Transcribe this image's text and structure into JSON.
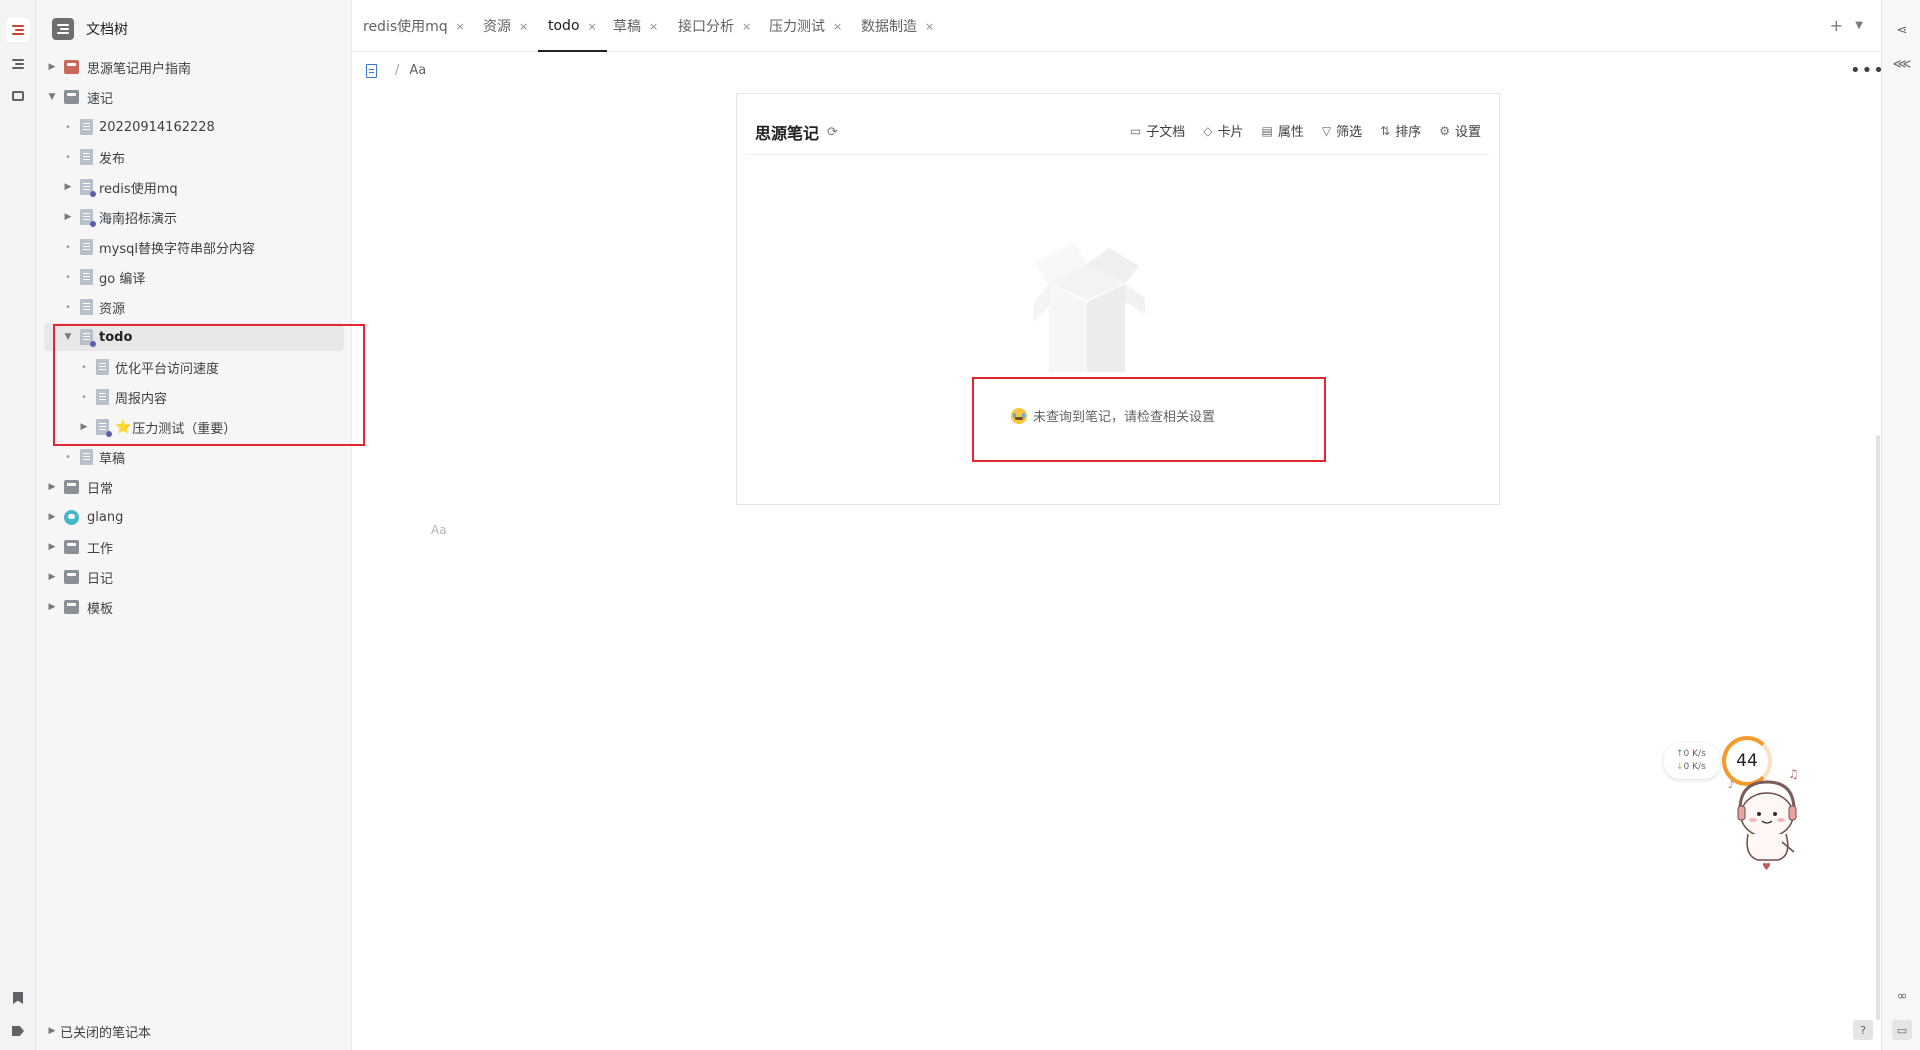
{
  "sidebar": {
    "title": "文档树",
    "items": [
      {
        "label": "思源笔记用户指南"
      },
      {
        "label": "速记"
      },
      {
        "label": "20220914162228"
      },
      {
        "label": "发布"
      },
      {
        "label": "redis使用mq"
      },
      {
        "label": "海南招标演示"
      },
      {
        "label": "mysql替换字符串部分内容"
      },
      {
        "label": "go 编译"
      },
      {
        "label": "资源"
      },
      {
        "label": "todo"
      },
      {
        "label": "优化平台访问速度"
      },
      {
        "label": "周报内容"
      },
      {
        "label": "压力测试（重要）",
        "icon": "⭐"
      },
      {
        "label": "草稿"
      },
      {
        "label": "日常"
      },
      {
        "label": "glang"
      },
      {
        "label": "工作"
      },
      {
        "label": "日记"
      },
      {
        "label": "模板"
      }
    ],
    "closed_notebooks": "已关闭的笔记本"
  },
  "tabs": [
    {
      "label": "redis使用mq"
    },
    {
      "label": "资源"
    },
    {
      "label": "todo"
    },
    {
      "label": "草稿"
    },
    {
      "label": "接口分析"
    },
    {
      "label": "压力测试"
    },
    {
      "label": "数据制造"
    }
  ],
  "tab_close": "×",
  "tab_add": "+",
  "tab_more": "▼",
  "breadcrumb": {
    "separator": "/",
    "current": "Aa"
  },
  "more_menu": "•••",
  "embed": {
    "title": "思源笔记",
    "refresh": "⟳",
    "tools": [
      {
        "label": "子文档",
        "icon": "folder-icon",
        "glyph": "▭"
      },
      {
        "label": "卡片",
        "icon": "card-icon",
        "glyph": "◇"
      },
      {
        "label": "属性",
        "icon": "attribute-icon",
        "glyph": "▤"
      },
      {
        "label": "筛选",
        "icon": "filter-icon",
        "glyph": "▽"
      },
      {
        "label": "排序",
        "icon": "sort-icon",
        "glyph": "⇅"
      },
      {
        "label": "设置",
        "icon": "gear-icon",
        "glyph": "⚙"
      }
    ],
    "empty_message": "未查询到笔记，请检查相关设置"
  },
  "editor_placeholder": "Aa",
  "network_widget": {
    "up_value": "0",
    "down_value": "0",
    "unit": "K/s",
    "up_arrow": "↑",
    "down_arrow": "↓"
  },
  "cpu_value": "44",
  "colors": {
    "accent": "#d23f31",
    "highlight_box": "#e3262f",
    "tree_bg": "#f6f6f6",
    "cpu_ring": "#f39a2b"
  }
}
